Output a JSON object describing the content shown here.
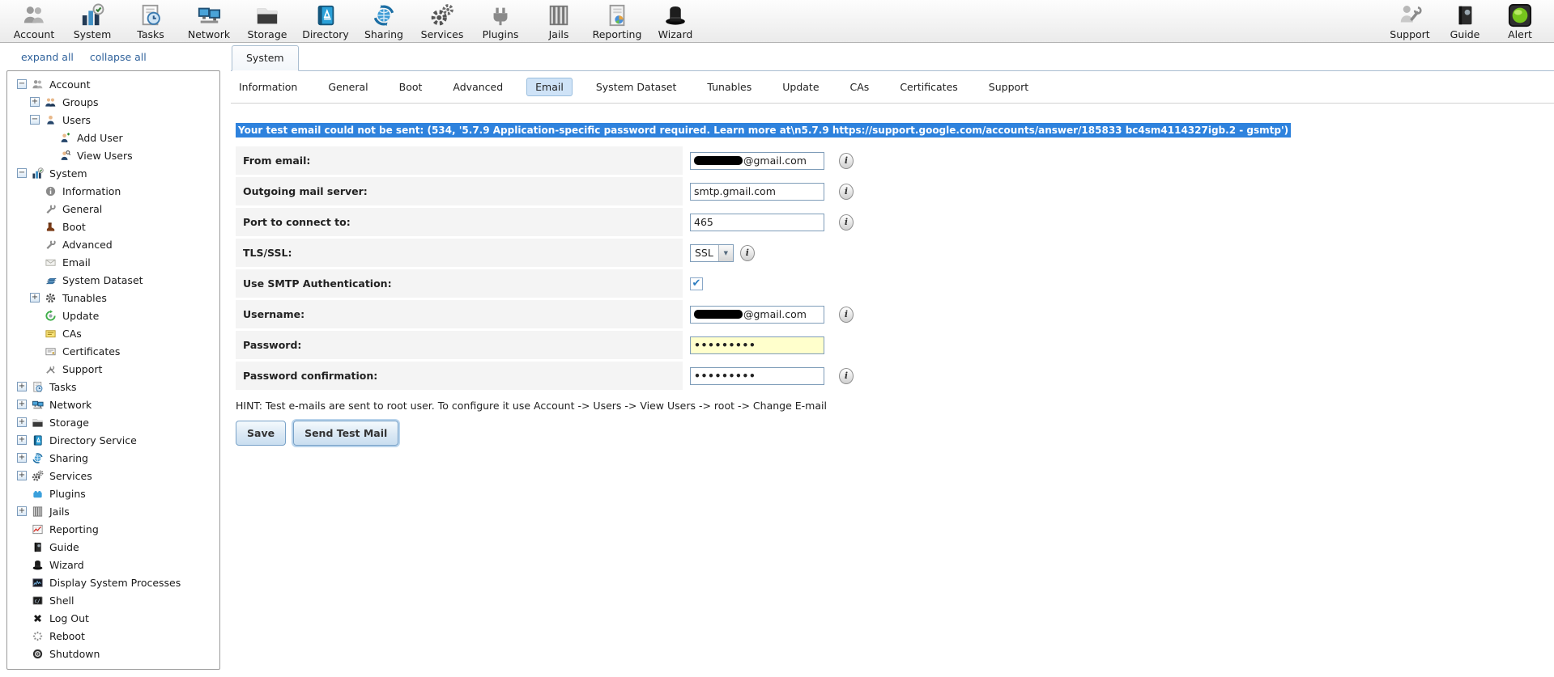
{
  "glyphs": {
    "info": "i",
    "check": "✔",
    "dropdown": "▼",
    "collapse": "−",
    "expand": "+"
  },
  "colors": {
    "selection_blue": "#2e82dd",
    "subtab_selected_bg": "#cfe3f7",
    "subtab_selected_border": "#9abede",
    "password_field_bg": "#ffffcc",
    "link_blue": "#31639c",
    "alert_green": "#76c51c"
  },
  "toolbar": {
    "items": [
      {
        "label": "Account",
        "icon": "people-gray-icon"
      },
      {
        "label": "System",
        "icon": "chart-check-icon"
      },
      {
        "label": "Tasks",
        "icon": "doc-clock-icon"
      },
      {
        "label": "Network",
        "icon": "monitors-icon"
      },
      {
        "label": "Storage",
        "icon": "folder-icon"
      },
      {
        "label": "Directory",
        "icon": "book-blue-icon"
      },
      {
        "label": "Sharing",
        "icon": "globe-sync-icon"
      },
      {
        "label": "Services",
        "icon": "gears-icon"
      },
      {
        "label": "Plugins",
        "icon": "plug-icon"
      },
      {
        "label": "Jails",
        "icon": "jail-bars-icon"
      },
      {
        "label": "Reporting",
        "icon": "doc-chart-icon"
      },
      {
        "label": "Wizard",
        "icon": "top-hat-icon"
      }
    ],
    "right_items": [
      {
        "label": "Support",
        "icon": "support-person-icon"
      },
      {
        "label": "Guide",
        "icon": "book-dark-icon"
      },
      {
        "label": "Alert",
        "icon": "alert-light-icon"
      }
    ]
  },
  "sidebar": {
    "expand_all": "expand all",
    "collapse_all": "collapse all",
    "tree": [
      {
        "label": "Account",
        "icon": "people-gray-icon",
        "level": 0,
        "exp": "minus"
      },
      {
        "label": "Groups",
        "icon": "people-blue-icon",
        "level": 1,
        "exp": "plus"
      },
      {
        "label": "Users",
        "icon": "person-icon",
        "level": 1,
        "exp": "minus"
      },
      {
        "label": "Add User",
        "icon": "person-add-icon",
        "level": 2,
        "exp": "none"
      },
      {
        "label": "View Users",
        "icon": "person-search-icon",
        "level": 2,
        "exp": "none"
      },
      {
        "label": "System",
        "icon": "chart-check-icon",
        "level": 0,
        "exp": "minus"
      },
      {
        "label": "Information",
        "icon": "info-circle-icon",
        "level": 1,
        "exp": "none"
      },
      {
        "label": "General",
        "icon": "wrench-icon",
        "level": 1,
        "exp": "none"
      },
      {
        "label": "Boot",
        "icon": "boot-icon",
        "level": 1,
        "exp": "none"
      },
      {
        "label": "Advanced",
        "icon": "wrench-icon",
        "level": 1,
        "exp": "none"
      },
      {
        "label": "Email",
        "icon": "envelope-icon",
        "level": 1,
        "exp": "none"
      },
      {
        "label": "System Dataset",
        "icon": "disk-stack-icon",
        "level": 1,
        "exp": "none"
      },
      {
        "label": "Tunables",
        "icon": "gear-dark-icon",
        "level": 1,
        "exp": "plus"
      },
      {
        "label": "Update",
        "icon": "refresh-green-icon",
        "level": 1,
        "exp": "none"
      },
      {
        "label": "CAs",
        "icon": "card-yellow-icon",
        "level": 1,
        "exp": "none"
      },
      {
        "label": "Certificates",
        "icon": "card-white-icon",
        "level": 1,
        "exp": "none"
      },
      {
        "label": "Support",
        "icon": "tools-icon",
        "level": 1,
        "exp": "none"
      },
      {
        "label": "Tasks",
        "icon": "doc-clock-icon",
        "level": 0,
        "exp": "plus"
      },
      {
        "label": "Network",
        "icon": "monitors-icon",
        "level": 0,
        "exp": "plus"
      },
      {
        "label": "Storage",
        "icon": "folder-icon",
        "level": 0,
        "exp": "plus"
      },
      {
        "label": "Directory Service",
        "icon": "book-blue-icon",
        "level": 0,
        "exp": "plus"
      },
      {
        "label": "Sharing",
        "icon": "globe-sync-icon",
        "level": 0,
        "exp": "plus"
      },
      {
        "label": "Services",
        "icon": "gears-icon",
        "level": 0,
        "exp": "plus"
      },
      {
        "label": "Plugins",
        "icon": "puzzle-blue-icon",
        "level": 0,
        "exp": "none"
      },
      {
        "label": "Jails",
        "icon": "jail-bars-icon",
        "level": 0,
        "exp": "plus"
      },
      {
        "label": "Reporting",
        "icon": "chart-red-icon",
        "level": 0,
        "exp": "none"
      },
      {
        "label": "Guide",
        "icon": "book-dark-icon",
        "level": 0,
        "exp": "none"
      },
      {
        "label": "Wizard",
        "icon": "top-hat-icon",
        "level": 0,
        "exp": "none"
      },
      {
        "label": "Display System Processes",
        "icon": "process-chart-icon",
        "level": 0,
        "exp": "none"
      },
      {
        "label": "Shell",
        "icon": "terminal-icon",
        "level": 0,
        "exp": "none"
      },
      {
        "label": "Log Out",
        "icon": "logout-x-icon",
        "level": 0,
        "exp": "none"
      },
      {
        "label": "Reboot",
        "icon": "reboot-spinner-icon",
        "level": 0,
        "exp": "none"
      },
      {
        "label": "Shutdown",
        "icon": "power-icon",
        "level": 0,
        "exp": "none"
      }
    ]
  },
  "main": {
    "window_tab": "System",
    "subtabs": [
      {
        "label": "Information",
        "selected": false
      },
      {
        "label": "General",
        "selected": false
      },
      {
        "label": "Boot",
        "selected": false
      },
      {
        "label": "Advanced",
        "selected": false
      },
      {
        "label": "Email",
        "selected": true
      },
      {
        "label": "System Dataset",
        "selected": false
      },
      {
        "label": "Tunables",
        "selected": false
      },
      {
        "label": "Update",
        "selected": false
      },
      {
        "label": "CAs",
        "selected": false
      },
      {
        "label": "Certificates",
        "selected": false
      },
      {
        "label": "Support",
        "selected": false
      }
    ],
    "error_message": "Your test email could not be sent: (534, '5.7.9 Application-specific password required. Learn more at\\n5.7.9 https://support.google.com/accounts/answer/185833 bc4sm4114327igb.2 - gsmtp')",
    "form": {
      "rows": [
        {
          "label": "From email:",
          "type": "text",
          "value": "@gmail.com",
          "redacted": true,
          "info": true
        },
        {
          "label": "Outgoing mail server:",
          "type": "text",
          "value": "smtp.gmail.com",
          "redacted": false,
          "info": true
        },
        {
          "label": "Port to connect to:",
          "type": "text",
          "value": "465",
          "redacted": false,
          "info": true
        },
        {
          "label": "TLS/SSL:",
          "type": "select",
          "value": "SSL",
          "info": true
        },
        {
          "label": "Use SMTP Authentication:",
          "type": "checkbox",
          "checked": true,
          "info": false
        },
        {
          "label": "Username:",
          "type": "text",
          "value": "@gmail.com",
          "redacted": true,
          "info": true
        },
        {
          "label": "Password:",
          "type": "password",
          "value": "•••••••••",
          "highlight": true,
          "info": false
        },
        {
          "label": "Password confirmation:",
          "type": "password",
          "value": "•••••••••",
          "highlight": false,
          "info": true
        }
      ]
    },
    "hint": "HINT: Test e-mails are sent to root user. To configure it use Account -> Users -> View Users -> root -> Change E-mail",
    "buttons": {
      "save": "Save",
      "send_test": "Send Test Mail"
    }
  }
}
